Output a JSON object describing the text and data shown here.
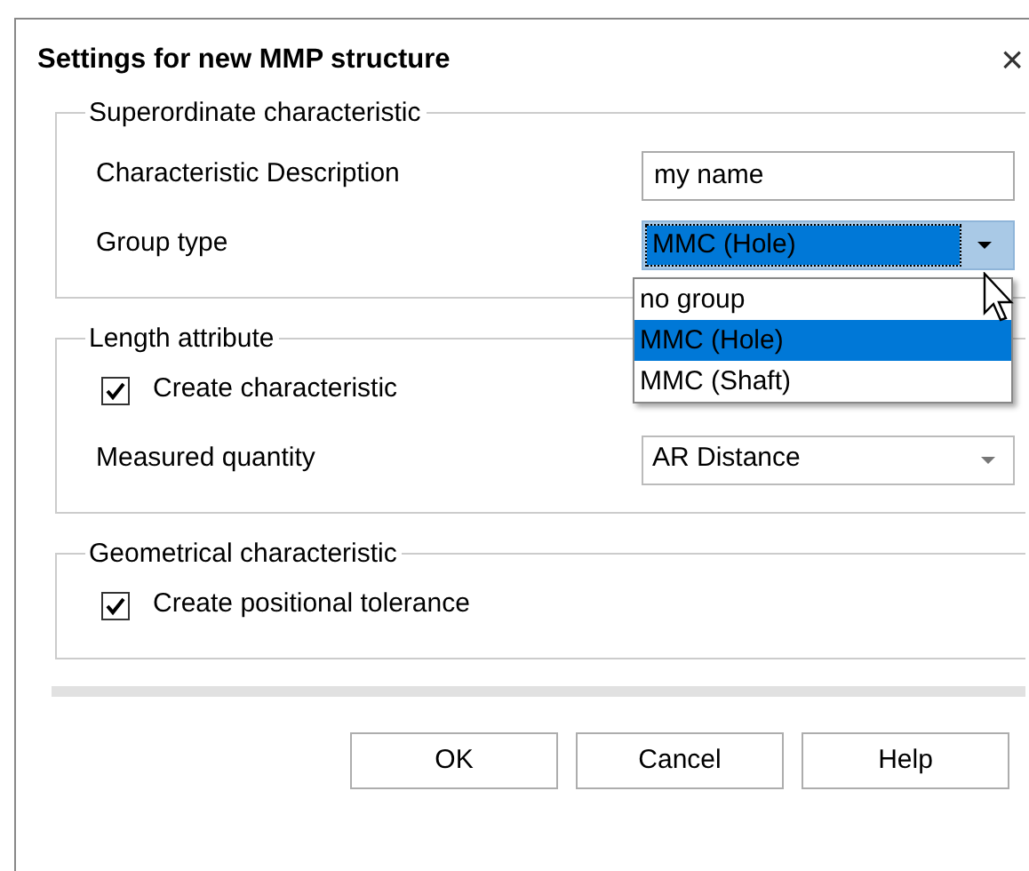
{
  "dialog": {
    "title": "Settings for new MMP structure",
    "close": "×"
  },
  "groups": [
    {
      "title": "Superordinate characteristic",
      "rows": [
        {
          "kind": "text",
          "label": "Characteristic Description",
          "value": "my name"
        },
        {
          "kind": "combo",
          "label": "Group type",
          "value": "MMC (Hole)",
          "expanded": true,
          "options": [
            {
              "label": "no group",
              "selected": false
            },
            {
              "label": "MMC (Hole)",
              "selected": true
            },
            {
              "label": "MMC (Shaft)",
              "selected": false
            }
          ]
        }
      ]
    },
    {
      "title": "Length attribute",
      "rows": [
        {
          "kind": "checkbox",
          "label": "Create characteristic",
          "checked": true
        },
        {
          "kind": "combo",
          "label": "Measured quantity",
          "value": "AR Distance",
          "expanded": false
        }
      ]
    },
    {
      "title": "Geometrical characteristic",
      "rows": [
        {
          "kind": "checkbox",
          "label": "Create positional tolerance",
          "checked": true
        }
      ]
    }
  ],
  "buttons": [
    "OK",
    "Cancel",
    "Help"
  ]
}
